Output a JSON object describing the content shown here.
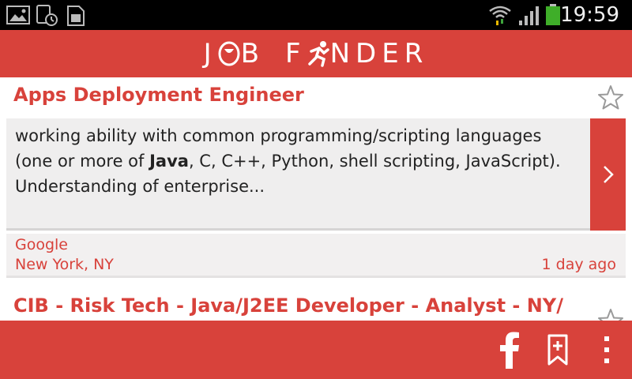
{
  "status_bar": {
    "time": "19:59",
    "icons": [
      "gallery-icon",
      "screenshot-icon",
      "sim-icon",
      "wifi-icon",
      "signal-icon",
      "battery-icon"
    ]
  },
  "header": {
    "logo_word1": "JOB",
    "logo_word2": "FINDER",
    "logo_word1_display": [
      "J",
      "B"
    ],
    "logo_word2_display": [
      "F",
      "NDER"
    ]
  },
  "jobs": [
    {
      "title": "Apps Deployment Engineer",
      "snippet_before": "working ability with common programming/scripting languages (one or more of ",
      "snippet_bold": "Java",
      "snippet_after": ", C, C++, Python, shell scripting, JavaScript). Understanding of enterprise...",
      "company": "Google",
      "location": "New York, NY",
      "posted": "1 day ago",
      "starred": false
    },
    {
      "title": "CIB - Risk Tech - Java/J2EE Developer - Analyst - NY/",
      "starred": false
    }
  ],
  "actions": [
    "facebook-icon",
    "bookmark-add-icon",
    "overflow-menu-icon"
  ],
  "colors": {
    "brand_red": "#d8423b",
    "card_gray": "#efeeee",
    "status_bar": "#000000"
  }
}
